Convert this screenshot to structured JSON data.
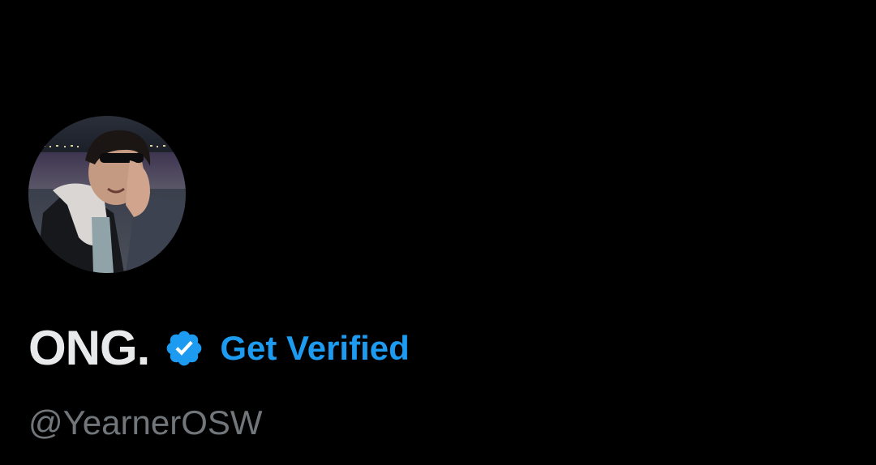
{
  "profile": {
    "display_name": "ONG.",
    "verified_icon": "verified-badge-icon",
    "get_verified_label": "Get Verified",
    "handle": "@YearnerOSW",
    "avatar_description_icon": "avatar-photo"
  },
  "colors": {
    "background": "#000000",
    "name": "#e7e9ea",
    "accent": "#1d9bf0",
    "handle": "#71767b"
  }
}
